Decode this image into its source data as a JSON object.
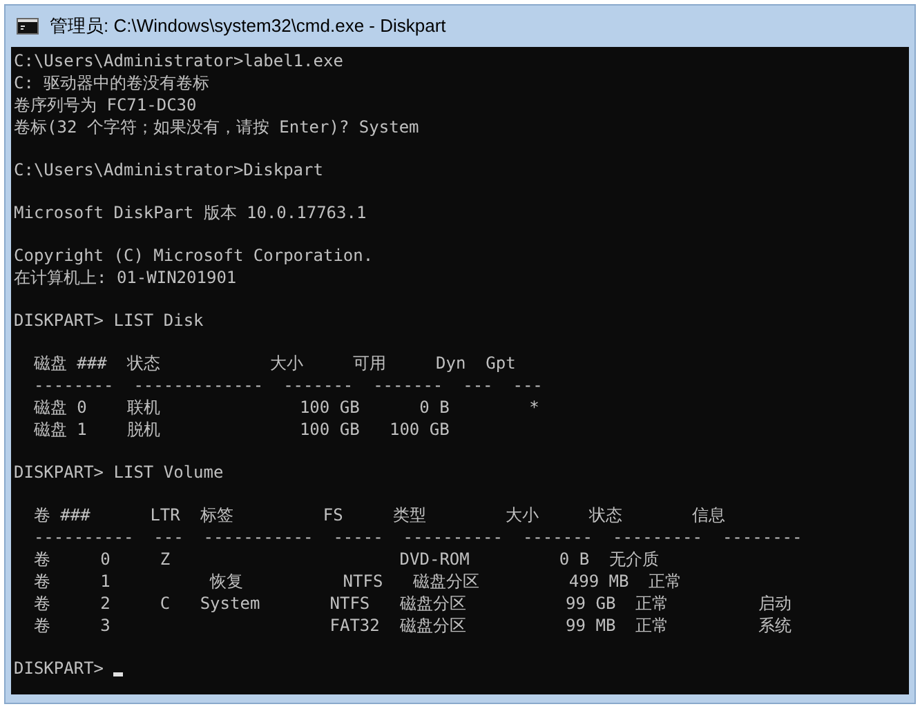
{
  "window": {
    "title": "管理员: C:\\Windows\\system32\\cmd.exe - Diskpart"
  },
  "console": {
    "blocks": [
      [
        "C:\\Users\\Administrator>label1.exe",
        "C: 驱动器中的卷没有卷标",
        "卷序列号为 FC71-DC30",
        "卷标(32 个字符；如果没有，请按 Enter)? System"
      ],
      [
        "C:\\Users\\Administrator>Diskpart"
      ],
      [
        "Microsoft DiskPart 版本 10.0.17763.1"
      ],
      [
        "Copyright (C) Microsoft Corporation.",
        "在计算机上: 01-WIN201901"
      ],
      [
        "DISKPART> LIST Disk"
      ],
      [
        "  磁盘 ###  状态           大小     可用     Dyn  Gpt",
        "  --------  -------------  -------  -------  ---  ---",
        "  磁盘 0    联机              100 GB      0 B        *",
        "  磁盘 1    脱机              100 GB   100 GB"
      ],
      [
        "DISKPART> LIST Volume"
      ],
      [
        "  卷 ###      LTR  标签         FS     类型        大小     状态       信息",
        "  ----------  ---  -----------  -----  ----------  -------  ---------  --------",
        "  卷     0     Z                       DVD-ROM         0 B  无介质",
        "  卷     1          恢复          NTFS   磁盘分区         499 MB  正常",
        "  卷     2     C   System       NTFS   磁盘分区          99 GB  正常         启动",
        "  卷     3                      FAT32  磁盘分区          99 MB  正常         系统"
      ],
      [
        "DISKPART> "
      ]
    ],
    "cursor": true
  }
}
